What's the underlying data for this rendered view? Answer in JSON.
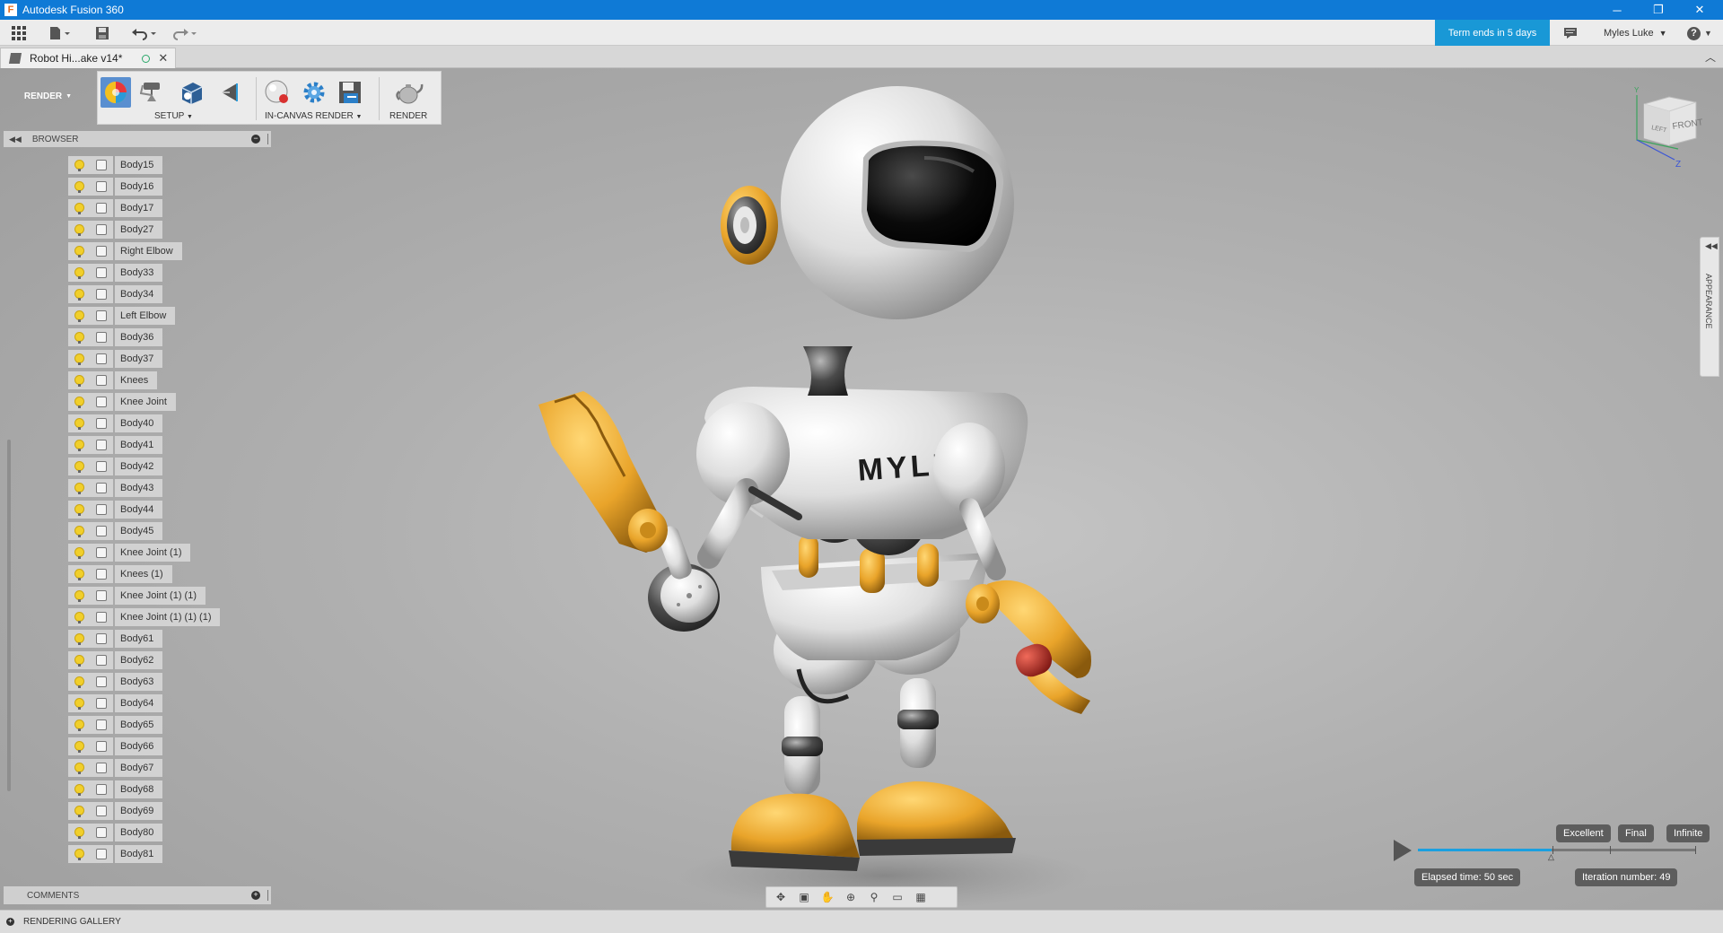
{
  "window": {
    "title": "Autodesk Fusion 360",
    "app_logo": "F",
    "controls": {
      "minimize": "─",
      "restore": "❐",
      "close": "✕"
    }
  },
  "menubar": {
    "term_badge": "Term ends in 5 days",
    "user_name": "Myles Luke",
    "help_icon": "?"
  },
  "doc_tab": {
    "title": "Robot Hi...ake v14*"
  },
  "toolbar": {
    "workspace": "RENDER",
    "setup_label": "SETUP",
    "in_canvas_label": "IN-CANVAS RENDER",
    "render_label": "RENDER"
  },
  "browser": {
    "title": "BROWSER",
    "items": [
      {
        "label": "Body15"
      },
      {
        "label": "Body16"
      },
      {
        "label": "Body17"
      },
      {
        "label": "Body27"
      },
      {
        "label": "Right Elbow"
      },
      {
        "label": "Body33"
      },
      {
        "label": "Body34"
      },
      {
        "label": "Left Elbow"
      },
      {
        "label": "Body36"
      },
      {
        "label": "Body37"
      },
      {
        "label": "Knees"
      },
      {
        "label": "Knee Joint"
      },
      {
        "label": "Body40"
      },
      {
        "label": "Body41"
      },
      {
        "label": "Body42"
      },
      {
        "label": "Body43"
      },
      {
        "label": "Body44"
      },
      {
        "label": "Body45"
      },
      {
        "label": "Knee Joint (1)"
      },
      {
        "label": "Knees (1)"
      },
      {
        "label": "Knee Joint (1) (1)"
      },
      {
        "label": "Knee Joint (1) (1) (1)"
      },
      {
        "label": "Body61"
      },
      {
        "label": "Body62"
      },
      {
        "label": "Body63"
      },
      {
        "label": "Body64"
      },
      {
        "label": "Body65"
      },
      {
        "label": "Body66"
      },
      {
        "label": "Body67"
      },
      {
        "label": "Body68"
      },
      {
        "label": "Body69"
      },
      {
        "label": "Body80"
      },
      {
        "label": "Body81"
      }
    ]
  },
  "comments": {
    "title": "COMMENTS"
  },
  "gallery": {
    "title": "RENDERING GALLERY"
  },
  "appearance": {
    "label": "APPEARANCE"
  },
  "viewcube": {
    "left": "LEFT",
    "front": "FRONT",
    "axis_y": "Y",
    "axis_z": "Z"
  },
  "model": {
    "chest_text": "MYLES"
  },
  "render_progress": {
    "quality_excellent": "Excellent",
    "quality_final": "Final",
    "quality_infinite": "Infinite",
    "elapsed": "Elapsed time: 50 sec",
    "iteration": "Iteration number: 49",
    "progress": 0.48
  }
}
